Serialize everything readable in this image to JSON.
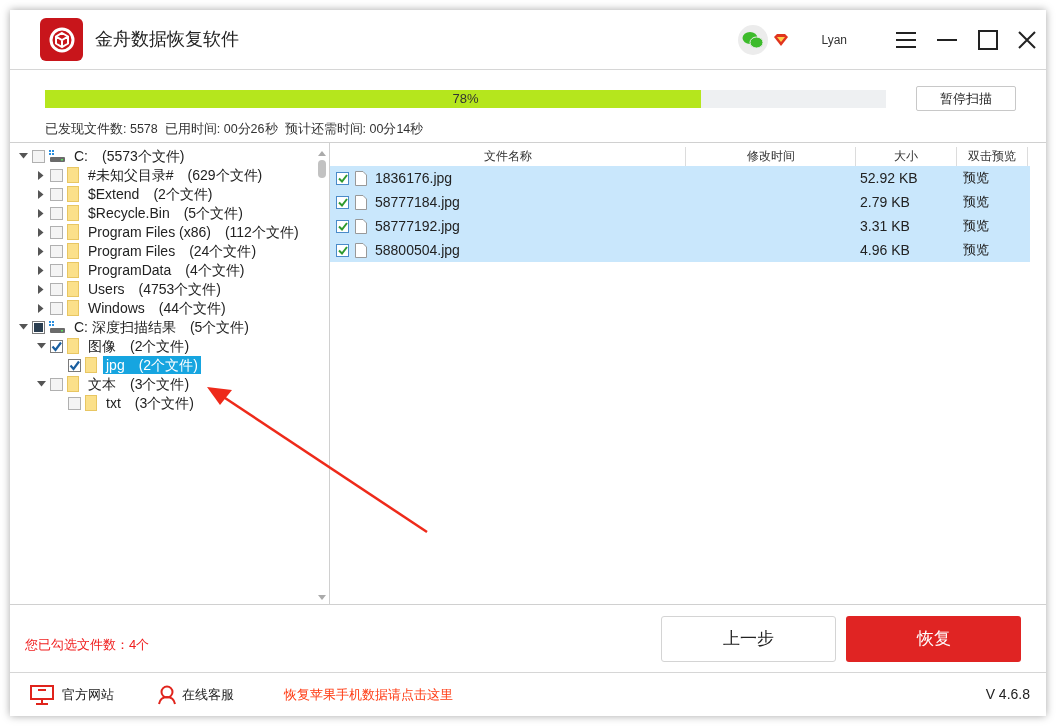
{
  "window": {
    "title": "金舟数据恢复软件",
    "user": "Lyan"
  },
  "scan": {
    "level": 0.78,
    "percent": "78%",
    "pause_button": "暂停扫描",
    "stats": [
      "已发现文件数: 5578",
      "已用时间: 00分26秒",
      "预计还需时间: 00分14秒"
    ]
  },
  "tree": [
    {
      "kind": "drive",
      "name": "C:",
      "count": "(5573个文件)",
      "expanded": true,
      "checked": false,
      "selected": false,
      "children": [
        {
          "kind": "folder",
          "name": "#未知父目录#",
          "count": "(629个文件)",
          "expanded": false,
          "checked": false,
          "selected": false
        },
        {
          "kind": "folder",
          "name": "$Extend",
          "count": "(2个文件)",
          "expanded": false,
          "checked": false,
          "selected": false
        },
        {
          "kind": "folder",
          "name": "$Recycle.Bin",
          "count": "(5个文件)",
          "expanded": false,
          "checked": false,
          "selected": false
        },
        {
          "kind": "folder",
          "name": "Program Files (x86)",
          "count": "(112个文件)",
          "expanded": false,
          "checked": false,
          "selected": false
        },
        {
          "kind": "folder",
          "name": "Program Files",
          "count": "(24个文件)",
          "expanded": false,
          "checked": false,
          "selected": false
        },
        {
          "kind": "folder",
          "name": "ProgramData",
          "count": "(4个文件)",
          "expanded": false,
          "checked": false,
          "selected": false
        },
        {
          "kind": "folder",
          "name": "Users",
          "count": "(4753个文件)",
          "expanded": false,
          "checked": false,
          "selected": false
        },
        {
          "kind": "folder",
          "name": "Windows",
          "count": "(44个文件)",
          "expanded": false,
          "checked": false,
          "selected": false
        }
      ]
    },
    {
      "kind": "drive",
      "name": "C: 深度扫描结果",
      "count": "(5个文件)",
      "expanded": true,
      "checked": false,
      "indeterminate": true,
      "selected": false,
      "children": [
        {
          "kind": "folder",
          "name": "图像",
          "count": "(2个文件)",
          "expanded": true,
          "checked": true,
          "selected": false,
          "children": [
            {
              "kind": "folder",
              "name": "jpg",
              "count": "(2个文件)",
              "checked": true,
              "selected": true
            }
          ]
        },
        {
          "kind": "folder",
          "name": "文本",
          "count": "(3个文件)",
          "expanded": true,
          "checked": false,
          "selected": false,
          "children": [
            {
              "kind": "folder",
              "name": "txt",
              "count": "(3个文件)",
              "checked": false,
              "selected": false
            }
          ]
        }
      ]
    }
  ],
  "table": {
    "columns": [
      "文件名称",
      "修改时间",
      "大小",
      "双击预览"
    ],
    "rows": [
      {
        "name": "1836176.jpg",
        "size": "52.92 KB",
        "preview": "预览",
        "checked": true,
        "selected": true
      },
      {
        "name": "58777184.jpg",
        "size": "2.79 KB",
        "preview": "预览",
        "checked": true,
        "selected": true
      },
      {
        "name": "58777192.jpg",
        "size": "3.31 KB",
        "preview": "预览",
        "checked": true,
        "selected": true
      },
      {
        "name": "58800504.jpg",
        "size": "4.96 KB",
        "preview": "预览",
        "checked": true,
        "selected": true
      }
    ]
  },
  "selected_count": "您已勾选文件数：4个",
  "buttons": {
    "back": "上一步",
    "recover": "恢复"
  },
  "footer": {
    "website": "官方网站",
    "support": "在线客服",
    "iphone_link": "恢复苹果手机数据请点击这里",
    "version": "V 4.6.8"
  }
}
